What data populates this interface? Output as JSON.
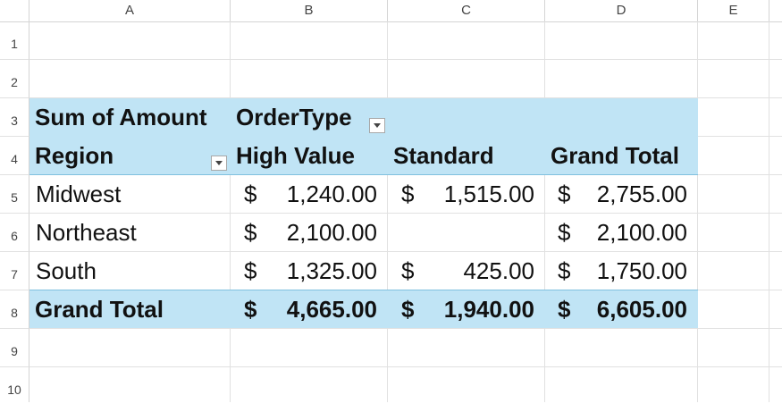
{
  "columns": [
    "A",
    "B",
    "C",
    "D",
    "E"
  ],
  "rows": [
    "1",
    "2",
    "3",
    "4",
    "5",
    "6",
    "7",
    "8",
    "9",
    "10"
  ],
  "pivot": {
    "header_row1": {
      "values_label": "Sum of Amount",
      "column_field": "OrderType"
    },
    "header_row2": {
      "row_field": "Region",
      "col1": "High Value",
      "col2": "Standard",
      "col3": "Grand Total"
    },
    "data_rows": [
      {
        "region": "Midwest",
        "high_sym": "$",
        "high": "1,240.00",
        "std_sym": "$",
        "std": "1,515.00",
        "total_sym": "$",
        "total": "2,755.00"
      },
      {
        "region": "Northeast",
        "high_sym": "$",
        "high": "2,100.00",
        "std_sym": "",
        "std": "",
        "total_sym": "$",
        "total": "2,100.00"
      },
      {
        "region": "South",
        "high_sym": "$",
        "high": "1,325.00",
        "std_sym": "$",
        "std": "425.00",
        "total_sym": "$",
        "total": "1,750.00"
      }
    ],
    "grand_total_row": {
      "label": "Grand Total",
      "high_sym": "$",
      "high": "4,665.00",
      "std_sym": "$",
      "std": "1,940.00",
      "total_sym": "$",
      "total": "6,605.00"
    }
  },
  "icons": {
    "filter_dropdown": "dropdown-arrow-icon"
  },
  "colors": {
    "pivot_band": "#c0e4f5",
    "grid": "#e1e1e1"
  }
}
